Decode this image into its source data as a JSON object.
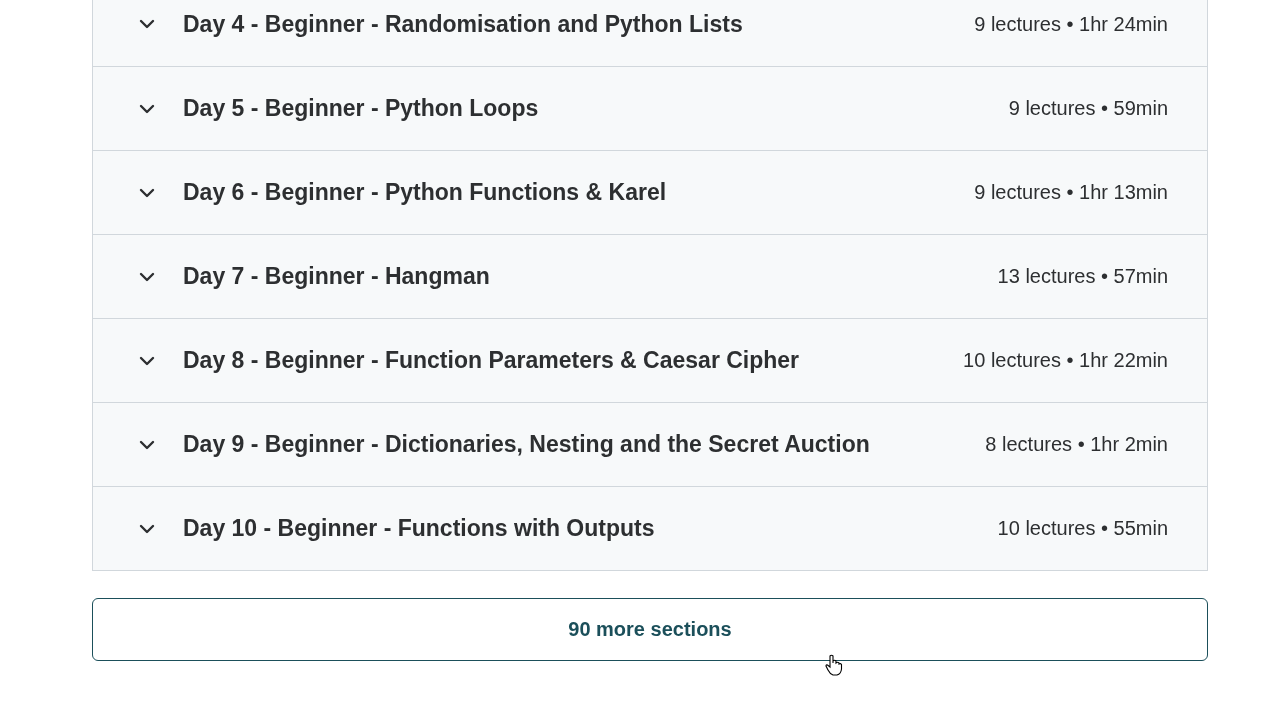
{
  "sections": [
    {
      "title": "Day 4 - Beginner - Randomisation and Python Lists",
      "meta": "9 lectures • 1hr 24min",
      "expanded": false
    },
    {
      "title": "Day 5 - Beginner - Python Loops",
      "meta": "9 lectures • 59min",
      "expanded": false
    },
    {
      "title": "Day 6 - Beginner - Python Functions & Karel",
      "meta": "9 lectures • 1hr 13min",
      "expanded": false
    },
    {
      "title": "Day 7 - Beginner - Hangman",
      "meta": "13 lectures • 57min",
      "expanded": false
    },
    {
      "title": "Day 8 - Beginner - Function Parameters & Caesar Cipher",
      "meta": "10 lectures • 1hr 22min",
      "expanded": false
    },
    {
      "title": "Day 9 - Beginner - Dictionaries, Nesting and the Secret Auction",
      "meta": "8 lectures • 1hr 2min",
      "expanded": false
    },
    {
      "title": "Day 10 - Beginner - Functions with Outputs",
      "meta": "10 lectures • 55min",
      "expanded": false
    }
  ],
  "more_button": "90 more sections"
}
